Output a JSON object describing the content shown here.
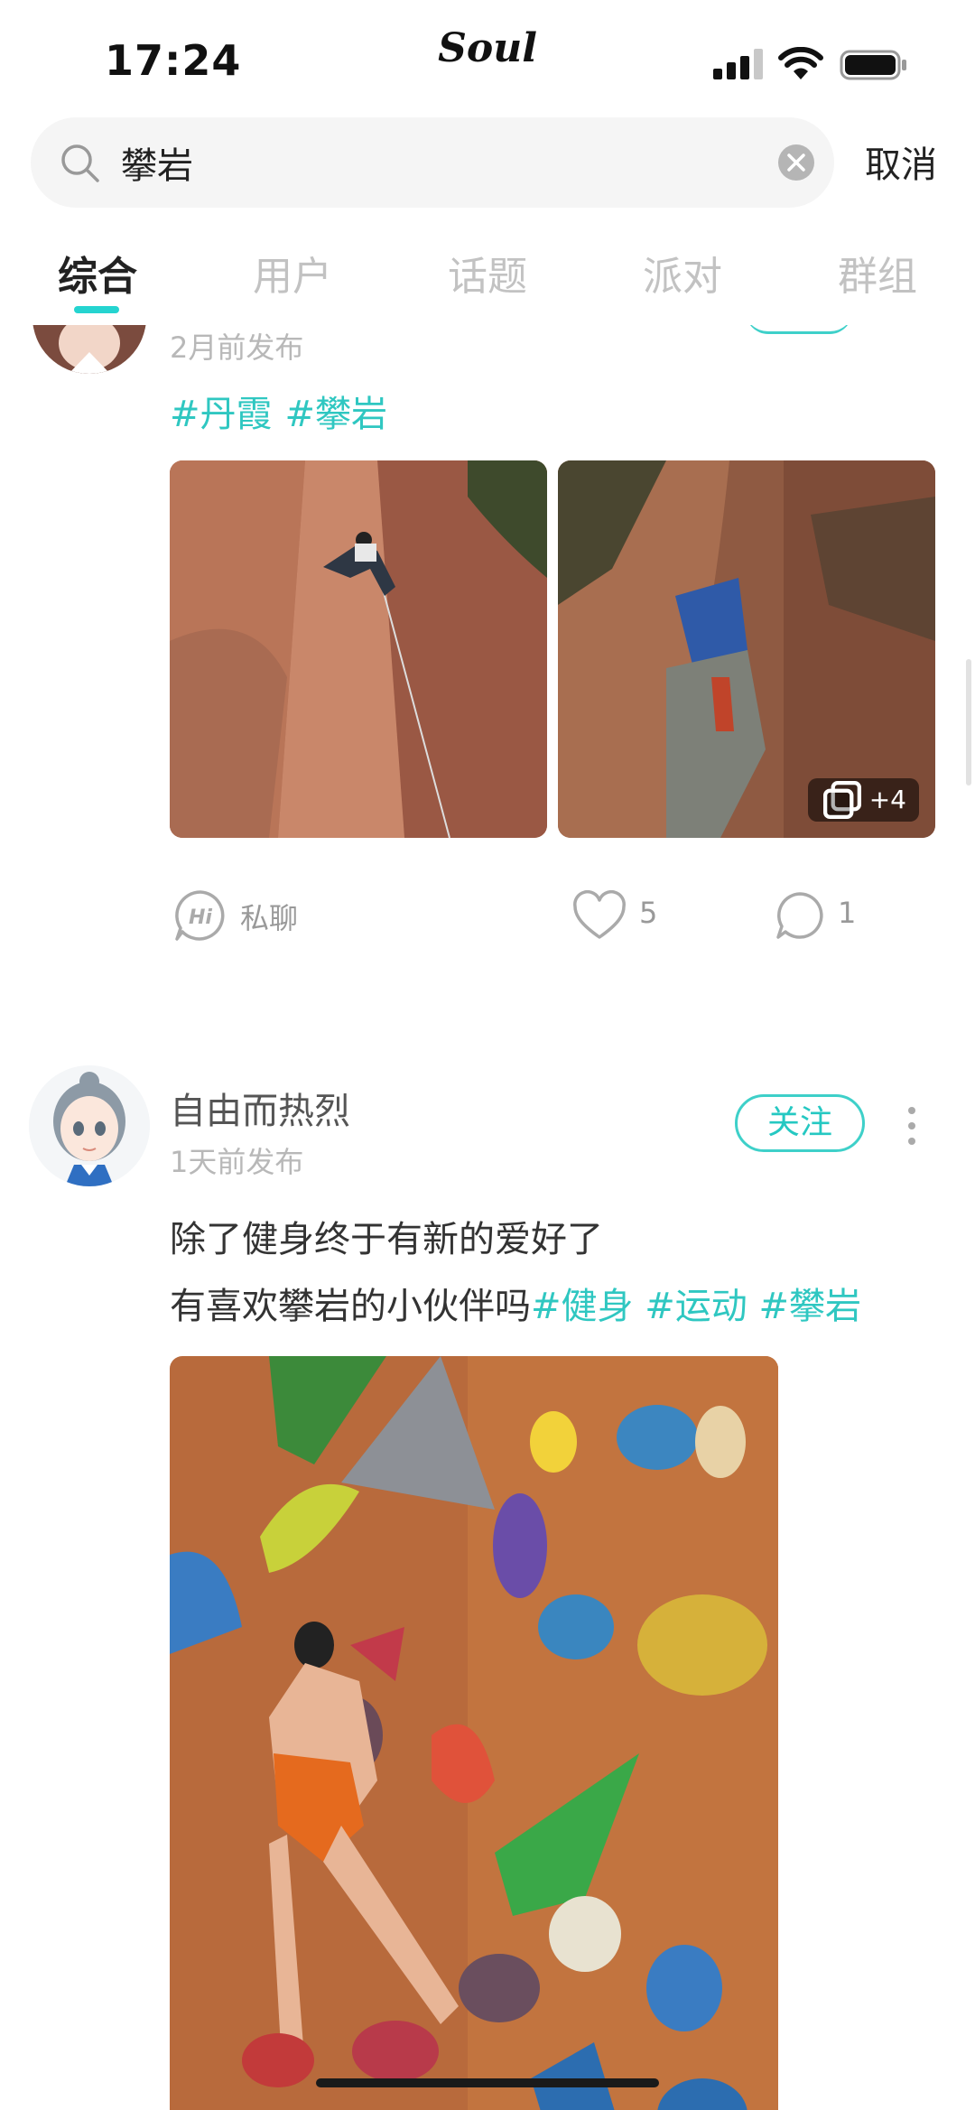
{
  "status_bar": {
    "time": "17:24",
    "app_name": "Soul"
  },
  "search": {
    "value": "攀岩",
    "cancel_label": "取消"
  },
  "tabs": [
    {
      "label": "综合",
      "active": true
    },
    {
      "label": "用户",
      "active": false
    },
    {
      "label": "话题",
      "active": false
    },
    {
      "label": "派对",
      "active": false
    },
    {
      "label": "群组",
      "active": false
    }
  ],
  "post1": {
    "time": "2月前发布",
    "tags": [
      "#丹霞",
      "#攀岩"
    ],
    "more_photos": "+4",
    "chat_label": "私聊",
    "likes": "5",
    "comments": "1"
  },
  "post2": {
    "username": "自由而热烈",
    "time": "1天前发布",
    "follow_label": "关注",
    "text_line1": "除了健身终于有新的爱好了",
    "text_line2": "有喜欢攀岩的小伙伴吗",
    "tags": [
      "#健身",
      "#运动",
      "#攀岩"
    ]
  },
  "colors": {
    "accent": "#25d4d0",
    "tag": "#2fc7c1",
    "muted": "#b8b8b8"
  }
}
